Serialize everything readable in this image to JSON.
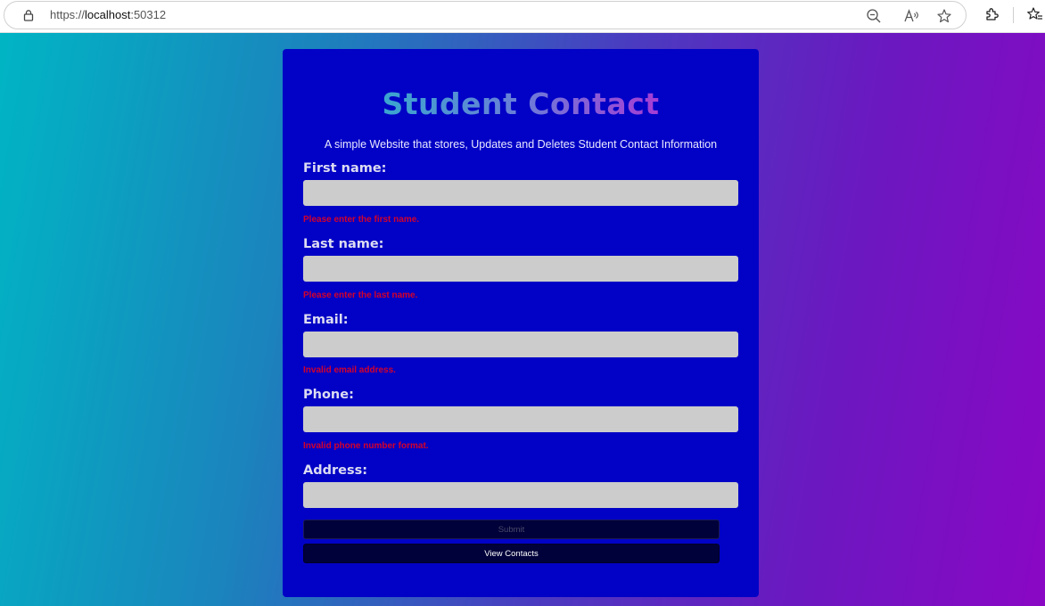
{
  "browser": {
    "url_scheme": "https://",
    "url_host": "localhost",
    "url_port": ":50312"
  },
  "form": {
    "title_part1": "Student ",
    "title_part2": "Contact",
    "subtitle": "A simple Website that stores, Updates and Deletes Student Contact Information",
    "fields": [
      {
        "label": "First name:",
        "value": "",
        "error": "Please enter the first name."
      },
      {
        "label": "Last name:",
        "value": "",
        "error": "Please enter the last name."
      },
      {
        "label": "Email:",
        "value": "",
        "error": "Invalid email address."
      },
      {
        "label": "Phone:",
        "value": "",
        "error": "Invalid phone number format."
      },
      {
        "label": "Address:",
        "value": "",
        "error": ""
      }
    ],
    "submit_label": "Submit",
    "view_contacts_label": "View Contacts"
  },
  "colors": {
    "card": "#0202c6",
    "input_bg": "#cccccc",
    "error": "#d4002b",
    "button_bg": "#00003a"
  }
}
